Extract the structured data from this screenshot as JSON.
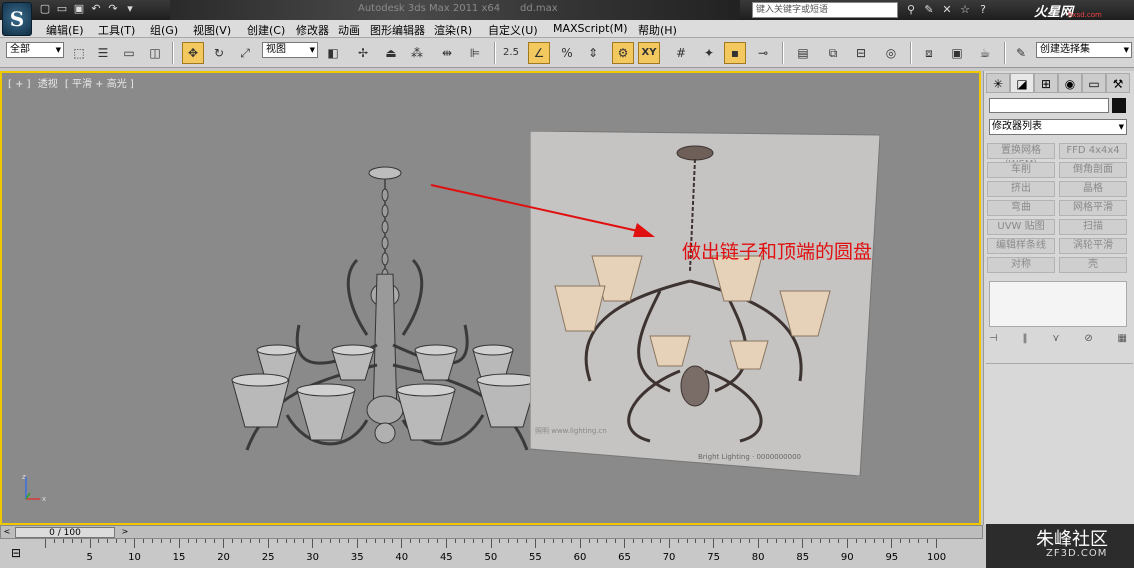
{
  "app": {
    "logo_glyph": "S",
    "title": "Autodesk 3ds Max  2011 x64",
    "file": "dd.max",
    "search_placeholder": "键入关键字或短语",
    "site_logo": "火星网",
    "site_sub": "hxsd.com"
  },
  "menu": [
    "编辑(E)",
    "工具(T)",
    "组(G)",
    "视图(V)",
    "创建(C)",
    "修改器",
    "动画",
    "图形编辑器",
    "渲染(R)",
    "自定义(U)",
    "MAXScript(M)",
    "帮助(H)"
  ],
  "toolbar": {
    "selection_filter": "全部",
    "ref_coord": "视图",
    "named_selection": "创建选择集",
    "snap_value": "2.5"
  },
  "viewport": {
    "label_parts": [
      "[ + ]",
      "透视",
      "[ 平滑 + 高光 ]"
    ],
    "annotation": "做出链子和顶端的圆盘",
    "axis_x": "x",
    "axis_z": "z"
  },
  "command_panel": {
    "modifier_list": "修改器列表",
    "modifiers": [
      "置换网格 (WSM)",
      "FFD 4x4x4",
      "车削",
      "倒角剖面",
      "挤出",
      "晶格",
      "弯曲",
      "网格平滑",
      "UVW 贴图",
      "扫描",
      "编辑样条线",
      "涡轮平滑",
      "对称",
      "壳"
    ]
  },
  "timeline": {
    "frame": "0 / 100",
    "ticks": [
      "0",
      "5",
      "10",
      "15",
      "20",
      "25",
      "30",
      "35",
      "40",
      "45",
      "50",
      "55",
      "60",
      "65",
      "70",
      "75",
      "80",
      "85",
      "90",
      "95",
      "100"
    ]
  },
  "watermark": {
    "main": "朱峰社区",
    "sub": "ZF3D.COM"
  }
}
